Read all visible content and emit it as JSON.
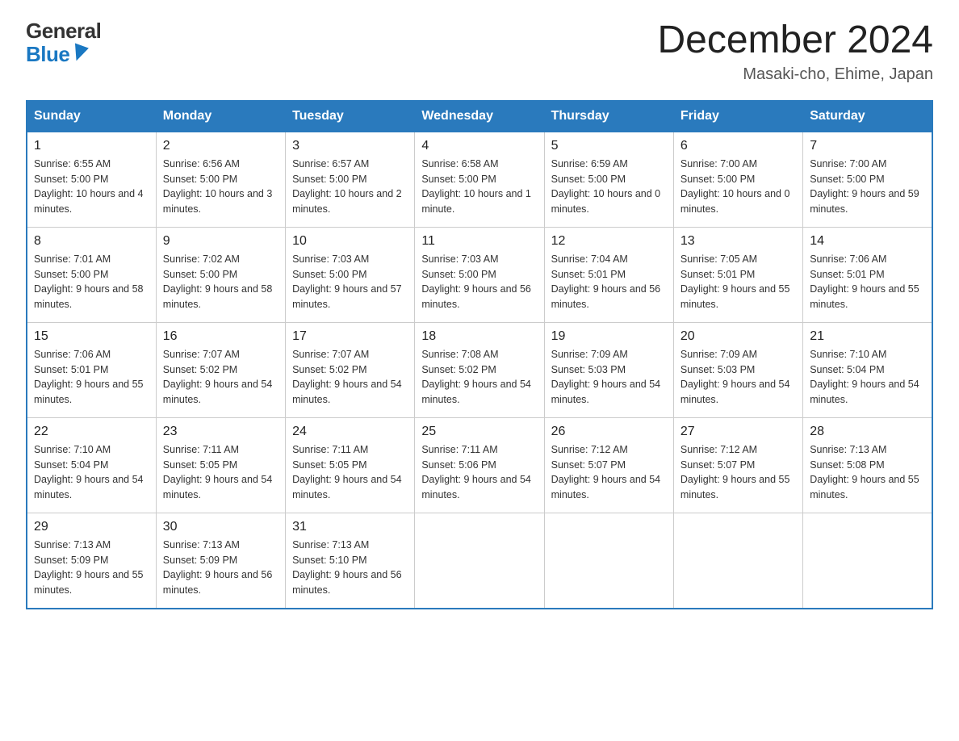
{
  "header": {
    "logo_general": "General",
    "logo_blue": "Blue",
    "month_title": "December 2024",
    "location": "Masaki-cho, Ehime, Japan"
  },
  "days_of_week": [
    "Sunday",
    "Monday",
    "Tuesday",
    "Wednesday",
    "Thursday",
    "Friday",
    "Saturday"
  ],
  "weeks": [
    [
      {
        "day": "1",
        "sunrise": "6:55 AM",
        "sunset": "5:00 PM",
        "daylight": "10 hours and 4 minutes."
      },
      {
        "day": "2",
        "sunrise": "6:56 AM",
        "sunset": "5:00 PM",
        "daylight": "10 hours and 3 minutes."
      },
      {
        "day": "3",
        "sunrise": "6:57 AM",
        "sunset": "5:00 PM",
        "daylight": "10 hours and 2 minutes."
      },
      {
        "day": "4",
        "sunrise": "6:58 AM",
        "sunset": "5:00 PM",
        "daylight": "10 hours and 1 minute."
      },
      {
        "day": "5",
        "sunrise": "6:59 AM",
        "sunset": "5:00 PM",
        "daylight": "10 hours and 0 minutes."
      },
      {
        "day": "6",
        "sunrise": "7:00 AM",
        "sunset": "5:00 PM",
        "daylight": "10 hours and 0 minutes."
      },
      {
        "day": "7",
        "sunrise": "7:00 AM",
        "sunset": "5:00 PM",
        "daylight": "9 hours and 59 minutes."
      }
    ],
    [
      {
        "day": "8",
        "sunrise": "7:01 AM",
        "sunset": "5:00 PM",
        "daylight": "9 hours and 58 minutes."
      },
      {
        "day": "9",
        "sunrise": "7:02 AM",
        "sunset": "5:00 PM",
        "daylight": "9 hours and 58 minutes."
      },
      {
        "day": "10",
        "sunrise": "7:03 AM",
        "sunset": "5:00 PM",
        "daylight": "9 hours and 57 minutes."
      },
      {
        "day": "11",
        "sunrise": "7:03 AM",
        "sunset": "5:00 PM",
        "daylight": "9 hours and 56 minutes."
      },
      {
        "day": "12",
        "sunrise": "7:04 AM",
        "sunset": "5:01 PM",
        "daylight": "9 hours and 56 minutes."
      },
      {
        "day": "13",
        "sunrise": "7:05 AM",
        "sunset": "5:01 PM",
        "daylight": "9 hours and 55 minutes."
      },
      {
        "day": "14",
        "sunrise": "7:06 AM",
        "sunset": "5:01 PM",
        "daylight": "9 hours and 55 minutes."
      }
    ],
    [
      {
        "day": "15",
        "sunrise": "7:06 AM",
        "sunset": "5:01 PM",
        "daylight": "9 hours and 55 minutes."
      },
      {
        "day": "16",
        "sunrise": "7:07 AM",
        "sunset": "5:02 PM",
        "daylight": "9 hours and 54 minutes."
      },
      {
        "day": "17",
        "sunrise": "7:07 AM",
        "sunset": "5:02 PM",
        "daylight": "9 hours and 54 minutes."
      },
      {
        "day": "18",
        "sunrise": "7:08 AM",
        "sunset": "5:02 PM",
        "daylight": "9 hours and 54 minutes."
      },
      {
        "day": "19",
        "sunrise": "7:09 AM",
        "sunset": "5:03 PM",
        "daylight": "9 hours and 54 minutes."
      },
      {
        "day": "20",
        "sunrise": "7:09 AM",
        "sunset": "5:03 PM",
        "daylight": "9 hours and 54 minutes."
      },
      {
        "day": "21",
        "sunrise": "7:10 AM",
        "sunset": "5:04 PM",
        "daylight": "9 hours and 54 minutes."
      }
    ],
    [
      {
        "day": "22",
        "sunrise": "7:10 AM",
        "sunset": "5:04 PM",
        "daylight": "9 hours and 54 minutes."
      },
      {
        "day": "23",
        "sunrise": "7:11 AM",
        "sunset": "5:05 PM",
        "daylight": "9 hours and 54 minutes."
      },
      {
        "day": "24",
        "sunrise": "7:11 AM",
        "sunset": "5:05 PM",
        "daylight": "9 hours and 54 minutes."
      },
      {
        "day": "25",
        "sunrise": "7:11 AM",
        "sunset": "5:06 PM",
        "daylight": "9 hours and 54 minutes."
      },
      {
        "day": "26",
        "sunrise": "7:12 AM",
        "sunset": "5:07 PM",
        "daylight": "9 hours and 54 minutes."
      },
      {
        "day": "27",
        "sunrise": "7:12 AM",
        "sunset": "5:07 PM",
        "daylight": "9 hours and 55 minutes."
      },
      {
        "day": "28",
        "sunrise": "7:13 AM",
        "sunset": "5:08 PM",
        "daylight": "9 hours and 55 minutes."
      }
    ],
    [
      {
        "day": "29",
        "sunrise": "7:13 AM",
        "sunset": "5:09 PM",
        "daylight": "9 hours and 55 minutes."
      },
      {
        "day": "30",
        "sunrise": "7:13 AM",
        "sunset": "5:09 PM",
        "daylight": "9 hours and 56 minutes."
      },
      {
        "day": "31",
        "sunrise": "7:13 AM",
        "sunset": "5:10 PM",
        "daylight": "9 hours and 56 minutes."
      },
      null,
      null,
      null,
      null
    ]
  ],
  "labels": {
    "sunrise": "Sunrise:",
    "sunset": "Sunset:",
    "daylight": "Daylight:"
  }
}
